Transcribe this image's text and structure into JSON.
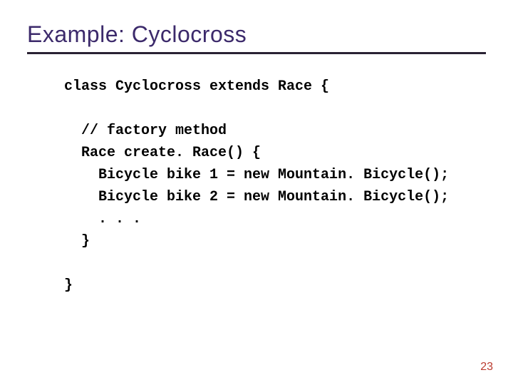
{
  "title": "Example:  Cyclocross",
  "code": {
    "l1": "class Cyclocross extends Race {",
    "l2": "",
    "l3": "  // factory method",
    "l4": "  Race create. Race() {",
    "l5": "    Bicycle bike 1 = new Mountain. Bicycle();",
    "l6": "    Bicycle bike 2 = new Mountain. Bicycle();",
    "l7": "    . . .",
    "l8": "  }",
    "l9": "",
    "l10": "}"
  },
  "page_number": "23"
}
